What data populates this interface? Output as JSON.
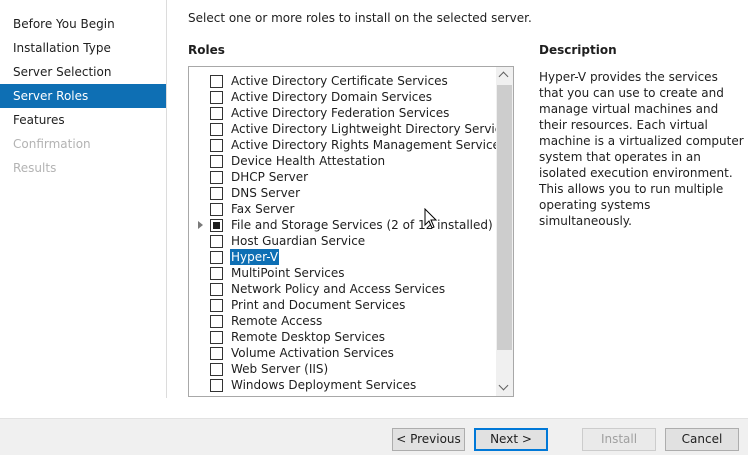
{
  "nav": {
    "items": [
      {
        "label": "Before You Begin",
        "state": "normal"
      },
      {
        "label": "Installation Type",
        "state": "normal"
      },
      {
        "label": "Server Selection",
        "state": "normal"
      },
      {
        "label": "Server Roles",
        "state": "selected"
      },
      {
        "label": "Features",
        "state": "normal"
      },
      {
        "label": "Confirmation",
        "state": "disabled"
      },
      {
        "label": "Results",
        "state": "disabled"
      }
    ]
  },
  "main": {
    "intro": "Select one or more roles to install on the selected server.",
    "roles_title": "Roles",
    "roles": [
      {
        "label": "Active Directory Certificate Services",
        "checked": false
      },
      {
        "label": "Active Directory Domain Services",
        "checked": false
      },
      {
        "label": "Active Directory Federation Services",
        "checked": false
      },
      {
        "label": "Active Directory Lightweight Directory Services",
        "checked": false
      },
      {
        "label": "Active Directory Rights Management Services",
        "checked": false
      },
      {
        "label": "Device Health Attestation",
        "checked": false
      },
      {
        "label": "DHCP Server",
        "checked": false
      },
      {
        "label": "DNS Server",
        "checked": false
      },
      {
        "label": "Fax Server",
        "checked": false
      },
      {
        "label": "File and Storage Services (2 of 12 installed)",
        "checked": "indeterminate",
        "expandable": true
      },
      {
        "label": "Host Guardian Service",
        "checked": false
      },
      {
        "label": "Hyper-V",
        "checked": false,
        "selected": true
      },
      {
        "label": "MultiPoint Services",
        "checked": false
      },
      {
        "label": "Network Policy and Access Services",
        "checked": false
      },
      {
        "label": "Print and Document Services",
        "checked": false
      },
      {
        "label": "Remote Access",
        "checked": false
      },
      {
        "label": "Remote Desktop Services",
        "checked": false
      },
      {
        "label": "Volume Activation Services",
        "checked": false
      },
      {
        "label": "Web Server (IIS)",
        "checked": false
      },
      {
        "label": "Windows Deployment Services",
        "checked": false
      }
    ],
    "description_title": "Description",
    "description": "Hyper-V provides the services that you can use to create and manage virtual machines and their resources. Each virtual machine is a virtualized computer system that operates in an isolated execution environment. This allows you to run multiple operating systems simultaneously."
  },
  "buttons": {
    "previous": "< Previous",
    "next": "Next >",
    "install": "Install",
    "cancel": "Cancel"
  },
  "colors": {
    "accent": "#0e6fb4",
    "button_focus": "#0078d7"
  },
  "icons": {
    "expander": "triangle-right-icon",
    "cursor": "arrow-pointer-icon"
  }
}
